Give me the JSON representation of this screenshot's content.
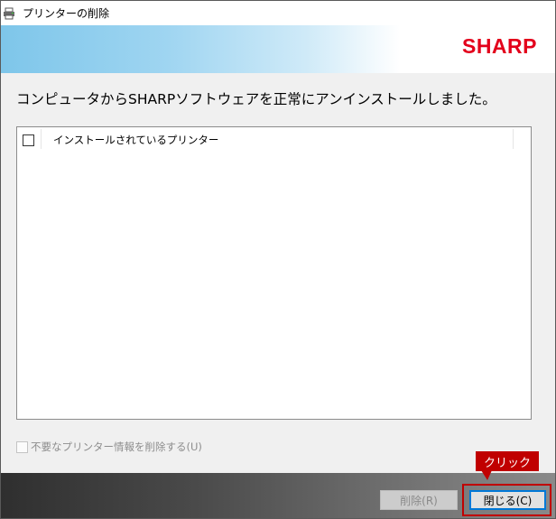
{
  "window": {
    "title": "プリンターの削除"
  },
  "banner": {
    "logo": "SHARP",
    "logo_color": "#e3001b"
  },
  "main": {
    "message": "コンピュータからSHARPソフトウェアを正常にアンインストールしました。",
    "list": {
      "header_label": "インストールされているプリンター",
      "header_checked": false,
      "items": []
    },
    "option": {
      "label": "不要なプリンター情報を削除する(U)",
      "checked": false,
      "enabled": false
    }
  },
  "buttons": {
    "remove_label": "削除(R)",
    "remove_enabled": false,
    "close_label": "閉じる(C)",
    "close_enabled": true
  },
  "annotation": {
    "callout_text": "クリック",
    "color": "#c00000"
  },
  "icons": {
    "title_icon": "printer-icon"
  }
}
